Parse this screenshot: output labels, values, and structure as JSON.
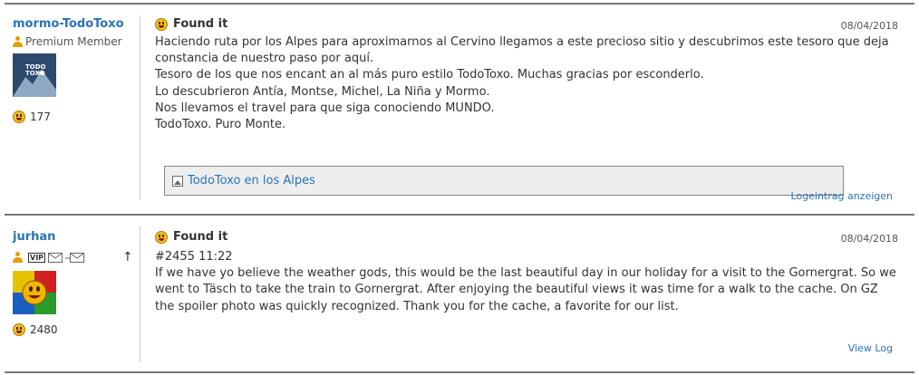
{
  "logs": [
    {
      "user": {
        "name": "mormo-TodoToxo",
        "rank": "Premium Member",
        "avatar_text": "TODO\nTOXO",
        "finds": "177"
      },
      "type": "Found it",
      "date": "08/04/2018",
      "lines": [
        "Haciendo ruta por los Alpes para aproximarnos al Cervino llegamos a este precioso sitio y descubrimos este tesoro que deja constancia de nuestro paso por aquí.",
        "Tesoro de los que nos encant an al más puro estilo TodoToxo. Muchas gracias por esconderlo.",
        "Lo descubrieron Antía, Montse, Michel, La Niña y Mormo.",
        "Nos llevamos el travel para que siga conociendo MUNDO.",
        "TodoToxo. Puro Monte."
      ],
      "image_link": "TodoToxo en los Alpes",
      "view_link": "Logeintrag anzeigen"
    },
    {
      "user": {
        "name": "jurhan",
        "vip": "VIP",
        "finds": "2480",
        "arrow": "↑"
      },
      "type": "Found it",
      "date": "08/04/2018",
      "lines": [
        "#2455 11:22",
        "If we have yo believe the weather gods, this would be the last beautiful day in our holiday for a visit to the Gornergrat. So we went to Täsch to take the train to Gornergrat. After enjoying the beautiful views it was time for a walk to the cache. On GZ the spoiler photo was quickly recognized. Thank you for the cache, a favorite for our list."
      ],
      "view_link": "View Log"
    }
  ],
  "colors": {
    "link": "#2a73b5",
    "border": "#777777",
    "avatar_bg": "#2b4a6e"
  },
  "icons": {
    "log_type": "smiley-icon",
    "finds": "smiley-icon",
    "rank": "person-icon",
    "image": "image-icon",
    "message": "envelope-icon"
  }
}
